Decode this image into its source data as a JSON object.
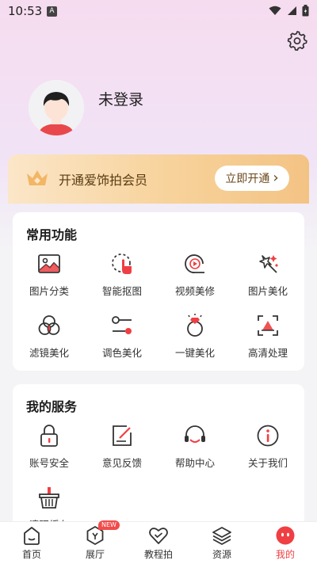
{
  "status": {
    "time": "10:53",
    "app_badge": "A"
  },
  "profile": {
    "login_text": "未登录"
  },
  "vip": {
    "text": "开通爱饰拍会员",
    "button": "立即开通",
    "button_arrow": "›"
  },
  "common": {
    "title": "常用功能",
    "items": [
      {
        "label": "图片分类",
        "icon": "image-icon"
      },
      {
        "label": "智能抠图",
        "icon": "smart-cutout-icon"
      },
      {
        "label": "视频美修",
        "icon": "video-play-icon"
      },
      {
        "label": "图片美化",
        "icon": "magic-sparkle-icon"
      },
      {
        "label": "滤镜美化",
        "icon": "filter-circles-icon"
      },
      {
        "label": "调色美化",
        "icon": "adjust-sliders-icon"
      },
      {
        "label": "一键美化",
        "icon": "diamond-ring-icon"
      },
      {
        "label": "高清处理",
        "icon": "hd-frame-icon"
      }
    ]
  },
  "service": {
    "title": "我的服务",
    "items": [
      {
        "label": "账号安全",
        "icon": "lock-icon"
      },
      {
        "label": "意见反馈",
        "icon": "feedback-edit-icon"
      },
      {
        "label": "帮助中心",
        "icon": "headset-icon"
      },
      {
        "label": "关于我们",
        "icon": "info-icon"
      },
      {
        "label": "清理缓存",
        "icon": "basket-icon"
      }
    ]
  },
  "tabs": [
    {
      "label": "首页",
      "icon": "home-icon"
    },
    {
      "label": "展厅",
      "icon": "gallery-icon",
      "badge": "NEW"
    },
    {
      "label": "教程拍",
      "icon": "heart-icon"
    },
    {
      "label": "资源",
      "icon": "layers-icon"
    },
    {
      "label": "我的",
      "icon": "mine-face-icon",
      "active": true
    }
  ],
  "colors": {
    "accent": "#ef3f43",
    "vip_text": "#5a3b12",
    "vip_gold": "#f3c384"
  }
}
